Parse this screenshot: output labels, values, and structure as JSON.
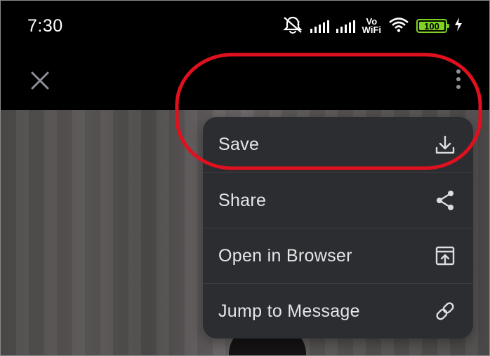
{
  "status_bar": {
    "time": "7:30",
    "icons": [
      "alarm-off-icon",
      "signal-icon",
      "signal-icon",
      "vowifi-icon",
      "wifi-icon",
      "battery-icon",
      "charging-icon"
    ],
    "vowifi_top": "Vo",
    "vowifi_bottom": "WiFi",
    "battery_level": "100",
    "battery_color": "#7ed321"
  },
  "top_bar": {
    "close_icon": "close-icon",
    "more_icon": "more-vertical-icon"
  },
  "menu": {
    "items": [
      {
        "label": "Save",
        "icon": "download-icon"
      },
      {
        "label": "Share",
        "icon": "share-icon"
      },
      {
        "label": "Open in Browser",
        "icon": "open-external-icon"
      },
      {
        "label": "Jump to Message",
        "icon": "link-icon"
      }
    ]
  },
  "annotation": {
    "type": "highlight-ellipse",
    "color": "#e0101e"
  },
  "colors": {
    "menu_bg": "#2b2d31",
    "menu_text": "#e6e6e8",
    "top_bar_bg": "#000000"
  }
}
